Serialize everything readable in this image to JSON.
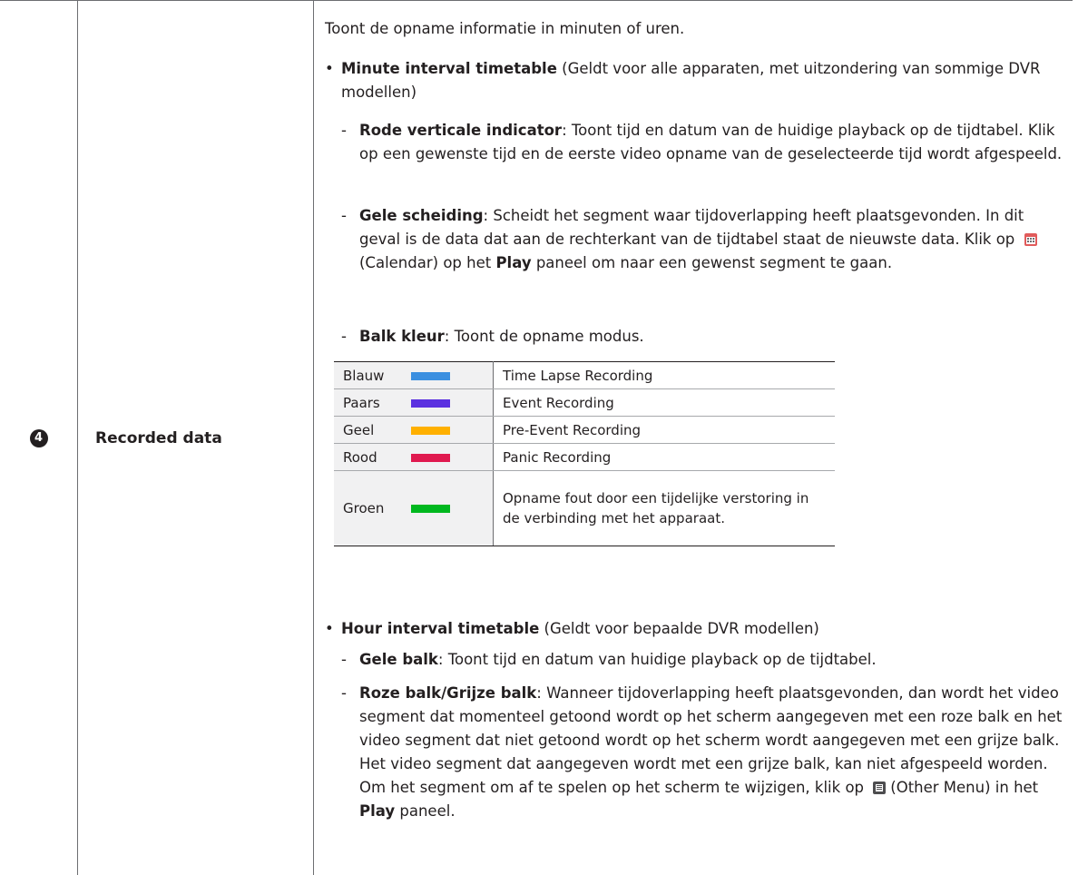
{
  "row": {
    "number": "4",
    "name": "Recorded data",
    "intro": "Toont de opname informatie in minuten of uren."
  },
  "minute": {
    "title": "Minute interval timetable",
    "note": " (Geldt voor alle apparaten, met uitzondering van sommige DVR modellen)",
    "items": [
      {
        "label": "Rode verticale indicator",
        "text": ": Toont tijd en datum van de huidige playback op de tijdtabel. Klik op een gewenste tijd en de eerste video opname van de geselecteerde tijd wordt afgespeeld."
      },
      {
        "label": "Gele scheiding",
        "text_a": ": Scheidt het segment waar tijdoverlapping heeft plaatsgevonden. In dit geval is de data dat aan de rechterkant van de tijdtabel staat de nieuwste data. Klik op ",
        "icon_label": "(Calendar) op het ",
        "play": "Play",
        "text_b": " paneel om naar een gewenst segment te gaan."
      },
      {
        "label": "Balk kleur",
        "text": ": Toont de opname modus."
      }
    ]
  },
  "colors": [
    {
      "name": "Blauw",
      "hex": "#3b8fe0",
      "desc": "Time Lapse Recording"
    },
    {
      "name": "Paars",
      "hex": "#5b31e0",
      "desc": "Event Recording"
    },
    {
      "name": "Geel",
      "hex": "#ffb000",
      "desc": "Pre-Event Recording"
    },
    {
      "name": "Rood",
      "hex": "#e0194f",
      "desc": "Panic Recording"
    },
    {
      "name": "Groen",
      "hex": "#00b81f",
      "desc": "Opname fout door een tijdelijke verstoring in de verbinding met het apparaat."
    }
  ],
  "hour": {
    "title": "Hour interval timetable",
    "note": "  (Geldt voor bepaalde DVR modellen)",
    "items": [
      {
        "label": "Gele balk",
        "text": ": Toont tijd en datum van huidige playback op de tijdtabel."
      },
      {
        "label": "Roze balk/Grijze balk",
        "text_a": ": Wanneer tijdoverlapping heeft plaatsgevonden, dan wordt het video segment dat momenteel getoond wordt op het scherm aangegeven met een roze balk en het video segment dat niet getoond wordt op het scherm wordt aangegeven met een grijze balk. Het video segment dat aangegeven wordt met een grijze balk, kan niet afgespeeld worden. Om het segment om af te spelen op het scherm te wijzigen, klik op ",
        "icon_label": "(Other Menu) in het ",
        "play": "Play",
        "text_b": " paneel."
      }
    ]
  },
  "icons": {
    "calendar": "calendar-icon",
    "other_menu": "other-menu-icon"
  }
}
